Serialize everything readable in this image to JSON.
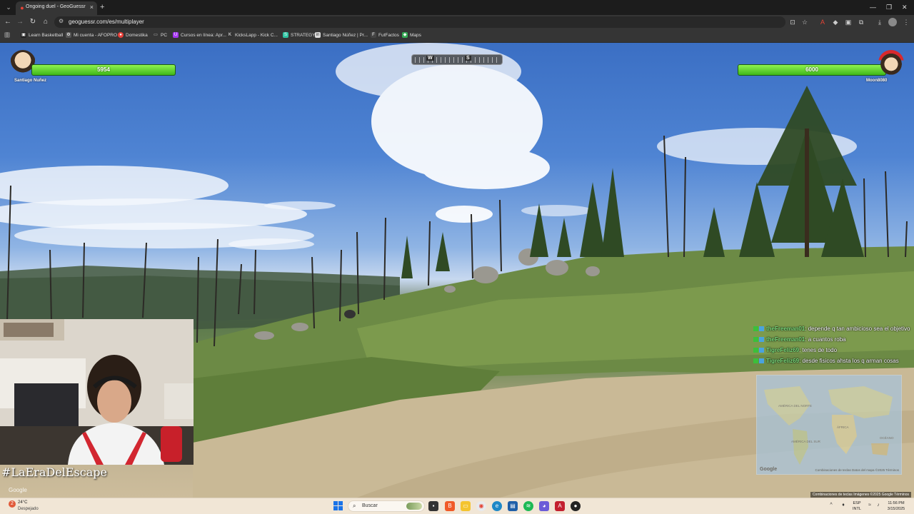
{
  "browser": {
    "tab_title": "Ongoing duel - GeoGuessr",
    "url": "geoguessr.com/es/multiplayer",
    "bookmarks": [
      {
        "label": "Learn Basketball",
        "icon": "learn-basketball-icon",
        "color": "#222222"
      },
      {
        "label": "Mi cuenta - AFOPRO",
        "icon": "gear-icon",
        "color": "#555555"
      },
      {
        "label": "Domestika",
        "icon": "domestika-icon",
        "color": "#e8413a"
      },
      {
        "label": "PC",
        "icon": "folder-icon",
        "color": "#777777"
      },
      {
        "label": "Cursos en línea: Apr...",
        "icon": "cursos-icon",
        "color": "#a435f0"
      },
      {
        "label": "KicksLapp - Kick C...",
        "icon": "kick-icon",
        "color": "#333333"
      },
      {
        "label": "STRATEGY",
        "icon": "strategy-icon",
        "color": "#2ec4a3"
      },
      {
        "label": "Santiago Núñez | Pr...",
        "icon": "profile-icon",
        "color": "#dddddd"
      },
      {
        "label": "FutFactos",
        "icon": "futfactos-icon",
        "color": "#444444"
      },
      {
        "label": "Maps",
        "icon": "maps-icon",
        "color": "#34a853"
      }
    ]
  },
  "game": {
    "player_left": {
      "name": "Santiago Nuñez",
      "hp": "5954"
    },
    "player_right": {
      "name": "Moon8080",
      "hp": "6000"
    },
    "compass_letters": [
      "W",
      "S"
    ]
  },
  "stream": {
    "hashtag": "#LaEraDelEscape",
    "chat": [
      {
        "user": "theFreeman01",
        "message": ": depende q tan ambicioso sea el objetivo"
      },
      {
        "user": "theFreeman01",
        "message": ": a cuantos roba"
      },
      {
        "user": "TigreFeliz69",
        "message": ": tenes de todo"
      },
      {
        "user": "TigreFeliz69",
        "message": ": desde fisicos ahsta los q arman cosas"
      }
    ]
  },
  "map": {
    "google_label": "Google",
    "attribution": "Combinaciones de teclas   Datos del mapa ©2025   Términos",
    "labels": [
      "AMÉRICA DEL NORTE",
      "ÁFRICA",
      "AMÉRICA DEL SUR",
      "OCÉANO"
    ],
    "footer_attribution": "Combinaciones de teclas   Imágenes ©2025 Google   Términos"
  },
  "streetview": {
    "google_label": "Google"
  },
  "taskbar": {
    "weather_temp": "24°C",
    "weather_desc": "Despejado",
    "weather_badge": "2",
    "search_placeholder": "Buscar",
    "lang_top": "ESP",
    "lang_bottom": "INTL",
    "time": "11:56 PM",
    "date": "3/15/2025"
  }
}
